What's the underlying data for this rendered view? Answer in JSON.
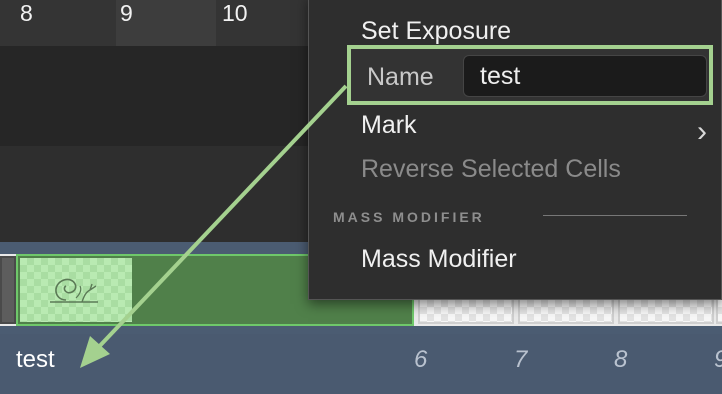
{
  "ruler": {
    "ticks": [
      "8",
      "9",
      "10"
    ]
  },
  "context_menu": {
    "set_exposure": "Set Exposure",
    "name_label": "Name",
    "name_value": "test",
    "mark": "Mark",
    "reverse_selected_cells": "Reverse Selected Cells",
    "section_mass_modifier": "MASS MODIFIER",
    "mass_modifier": "Mass Modifier"
  },
  "level": {
    "name": "test"
  },
  "frame_numbers": [
    "6",
    "7",
    "8",
    "9"
  ],
  "colors": {
    "selection_green": "#6fc86a",
    "annotation_green": "#a4d18f",
    "level_bar": "#4a5a70"
  }
}
